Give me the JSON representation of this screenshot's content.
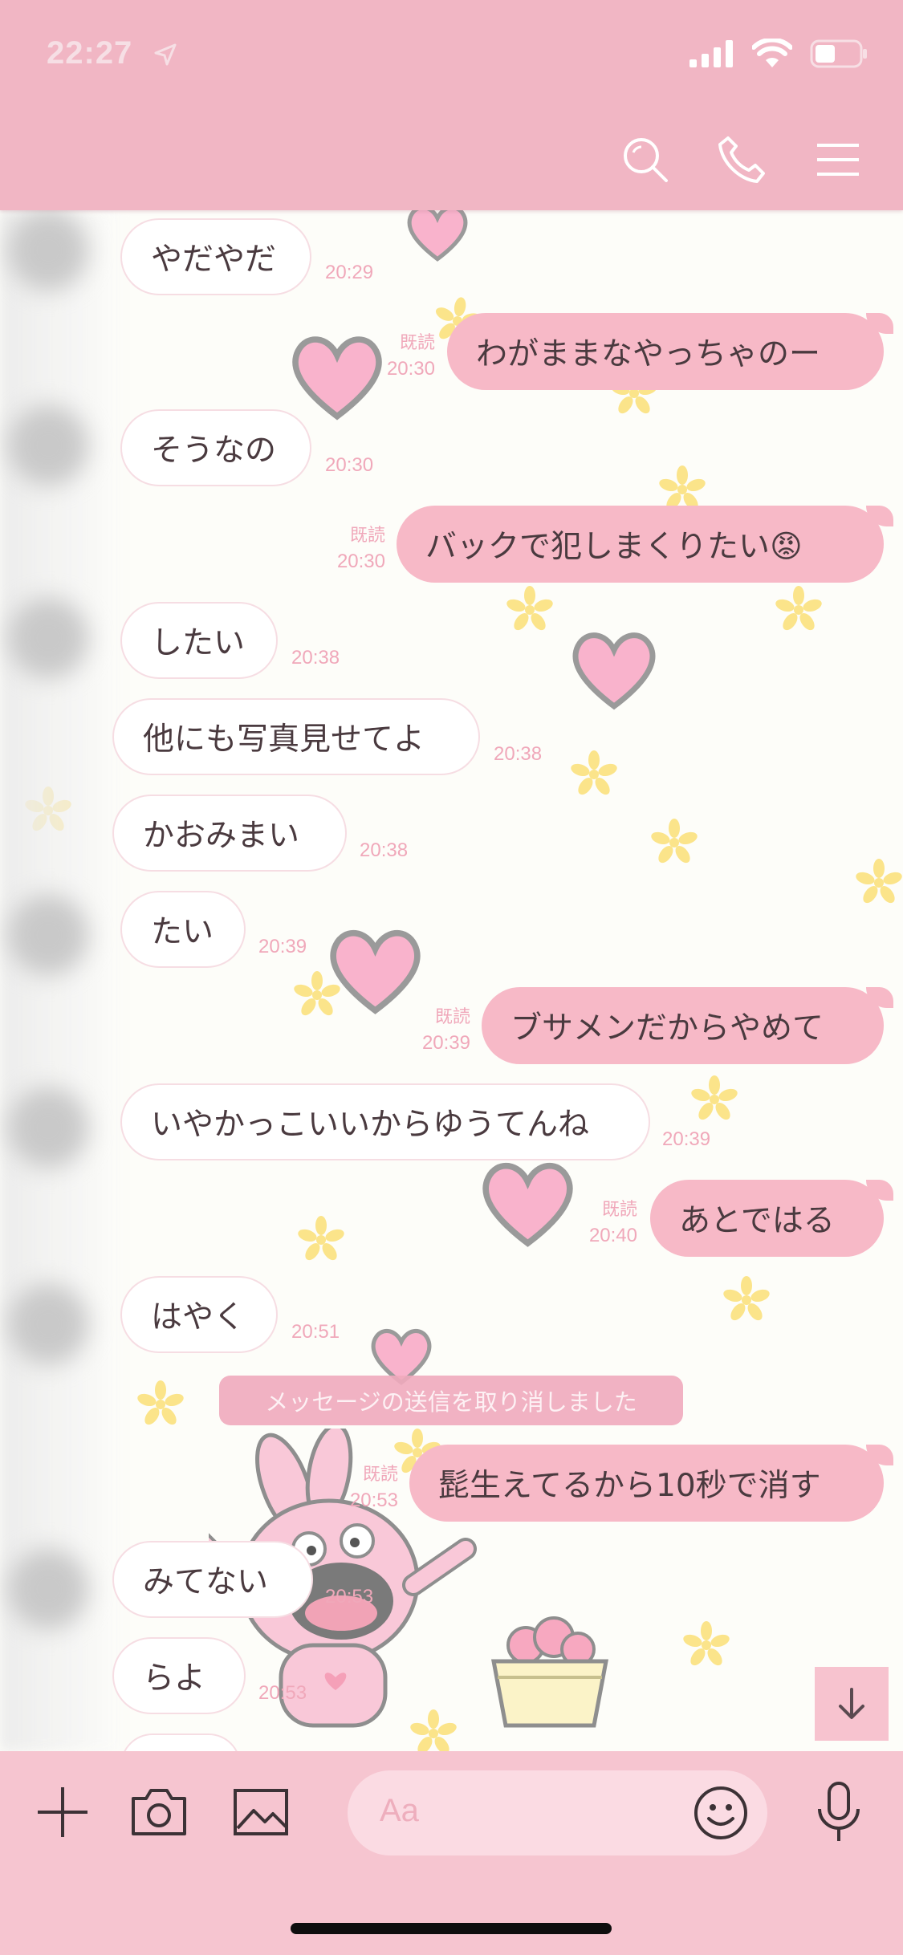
{
  "status_bar": {
    "time": "22:27"
  },
  "messages": [
    {
      "side": "left",
      "text": "やだやだ",
      "time": "20:29"
    },
    {
      "side": "right",
      "text": "わがままなやっちゃのー",
      "read": "既読",
      "time": "20:30"
    },
    {
      "side": "left",
      "text": "そうなの",
      "time": "20:30"
    },
    {
      "side": "right",
      "text": "バックで犯しまくりたい😡",
      "read": "既読",
      "time": "20:30"
    },
    {
      "side": "left",
      "text": "したい",
      "time": "20:38"
    },
    {
      "side": "left",
      "text": "他にも写真見せてよ",
      "time": "20:38"
    },
    {
      "side": "left",
      "text": "かおみまい",
      "time": "20:38"
    },
    {
      "side": "left",
      "text": "たい",
      "time": "20:39"
    },
    {
      "side": "right",
      "text": "ブサメンだからやめて",
      "read": "既読",
      "time": "20:39"
    },
    {
      "side": "left",
      "text": "いやかっこいいからゆうてんね",
      "time": "20:39"
    },
    {
      "side": "right",
      "text": "あとではる",
      "read": "既読",
      "time": "20:40"
    },
    {
      "side": "left",
      "text": "はやく",
      "time": "20:51"
    },
    {
      "side": "right",
      "text": "髭生えてるから10秒で消す",
      "read": "既読",
      "time": "20:53"
    },
    {
      "side": "left",
      "text": "みてない",
      "time": "20:53"
    },
    {
      "side": "left",
      "text": "らよ",
      "time": "20:53"
    }
  ],
  "system_message": "メッセージの送信を取り消しました",
  "input": {
    "placeholder": "Aa"
  },
  "colors": {
    "header": "#f1b6c4",
    "bubble_right": "#f7b9c7",
    "bottom_bar": "#f6c5d0",
    "timestamp": "#f0a8ba"
  }
}
